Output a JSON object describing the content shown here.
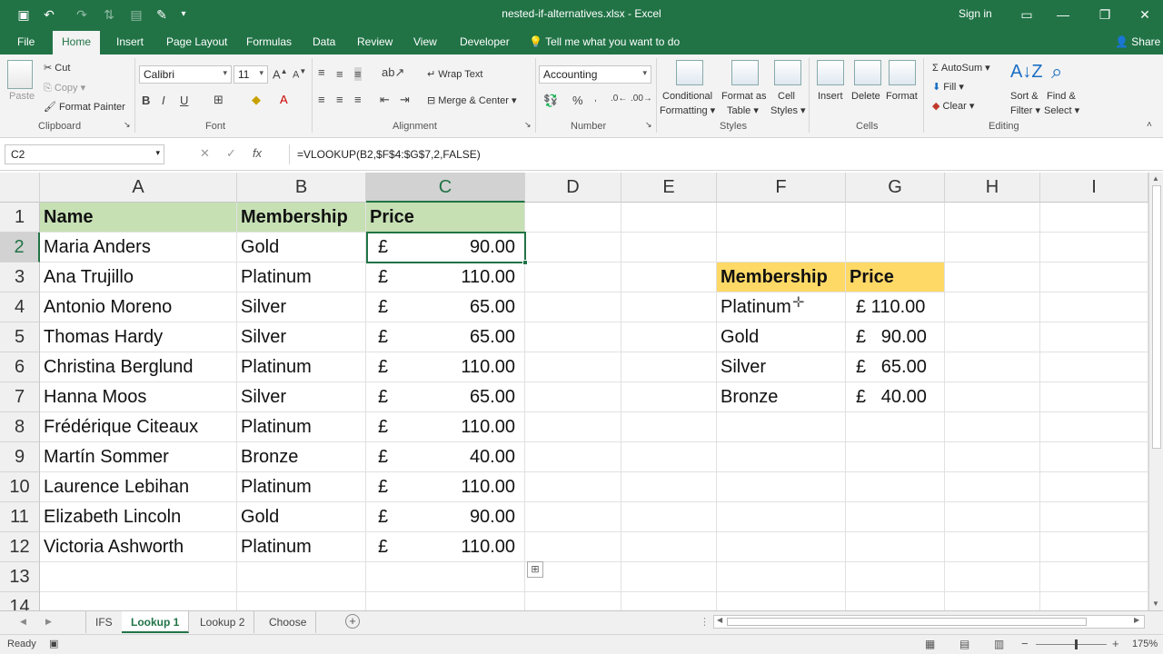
{
  "titlebar": {
    "title": "nested-if-alternatives.xlsx  -  Excel",
    "signin": "Sign in"
  },
  "tabs": [
    {
      "label": "File"
    },
    {
      "label": "Home"
    },
    {
      "label": "Insert"
    },
    {
      "label": "Page Layout"
    },
    {
      "label": "Formulas"
    },
    {
      "label": "Data"
    },
    {
      "label": "Review"
    },
    {
      "label": "View"
    },
    {
      "label": "Developer"
    }
  ],
  "tellme": "Tell me what you want to do",
  "share": "Share",
  "ribbon": {
    "paste": "Paste",
    "cut": "Cut",
    "copy": "Copy",
    "format_painter": "Format Painter",
    "clipboard": "Clipboard",
    "font_name": "Calibri",
    "font_size": "11",
    "font": "Font",
    "wrap_text": "Wrap Text",
    "merge_center": "Merge & Center",
    "alignment": "Alignment",
    "number_format": "Accounting",
    "number": "Number",
    "cond_format_1": "Conditional",
    "cond_format_2": "Formatting",
    "format_table_1": "Format as",
    "format_table_2": "Table",
    "cell_styles_1": "Cell",
    "cell_styles_2": "Styles",
    "styles": "Styles",
    "insert": "Insert",
    "delete": "Delete",
    "format": "Format",
    "cells": "Cells",
    "autosum": "AutoSum",
    "fill": "Fill",
    "clear": "Clear",
    "sort_filter_1": "Sort &",
    "sort_filter_2": "Filter",
    "find_select_1": "Find &",
    "find_select_2": "Select",
    "editing": "Editing"
  },
  "formula_bar": {
    "name_box": "C2",
    "formula": "=VLOOKUP(B2,$F$4:$G$7,2,FALSE)"
  },
  "columns": [
    "A",
    "B",
    "C",
    "D",
    "E",
    "F",
    "G",
    "H",
    "I"
  ],
  "rows": [
    "1",
    "2",
    "3",
    "4",
    "5",
    "6",
    "7",
    "8",
    "9",
    "10",
    "11",
    "12",
    "13",
    "14"
  ],
  "main_table": {
    "headers": [
      "Name",
      "Membership",
      "Price"
    ],
    "rows": [
      {
        "name": "Maria Anders",
        "membership": "Gold",
        "cur": "£",
        "price": "90.00"
      },
      {
        "name": "Ana Trujillo",
        "membership": "Platinum",
        "cur": "£",
        "price": "110.00"
      },
      {
        "name": "Antonio Moreno",
        "membership": "Silver",
        "cur": "£",
        "price": "65.00"
      },
      {
        "name": "Thomas Hardy",
        "membership": "Silver",
        "cur": "£",
        "price": "65.00"
      },
      {
        "name": "Christina Berglund",
        "membership": "Platinum",
        "cur": "£",
        "price": "110.00"
      },
      {
        "name": "Hanna Moos",
        "membership": "Silver",
        "cur": "£",
        "price": "65.00"
      },
      {
        "name": "Frédérique Citeaux",
        "membership": "Platinum",
        "cur": "£",
        "price": "110.00"
      },
      {
        "name": "Martín Sommer",
        "membership": "Bronze",
        "cur": "£",
        "price": "40.00"
      },
      {
        "name": "Laurence Lebihan",
        "membership": "Platinum",
        "cur": "£",
        "price": "110.00"
      },
      {
        "name": "Elizabeth Lincoln",
        "membership": "Gold",
        "cur": "£",
        "price": "90.00"
      },
      {
        "name": "Victoria Ashworth",
        "membership": "Platinum",
        "cur": "£",
        "price": "110.00"
      }
    ]
  },
  "lookup_table": {
    "headers": [
      "Membership",
      "Price"
    ],
    "rows": [
      {
        "membership": "Platinum",
        "price": "£ 110.00"
      },
      {
        "membership": "Gold",
        "price": "£   90.00"
      },
      {
        "membership": "Silver",
        "price": "£   65.00"
      },
      {
        "membership": "Bronze",
        "price": "£   40.00"
      }
    ]
  },
  "sheets": [
    "IFS",
    "Lookup 1",
    "Lookup 2",
    "Choose"
  ],
  "active_sheet": "Lookup 1",
  "status": {
    "ready": "Ready",
    "zoom": "175%"
  },
  "colors": {
    "excel_green": "#217346",
    "header_green": "#c6e0b4",
    "header_gold": "#ffd966"
  }
}
